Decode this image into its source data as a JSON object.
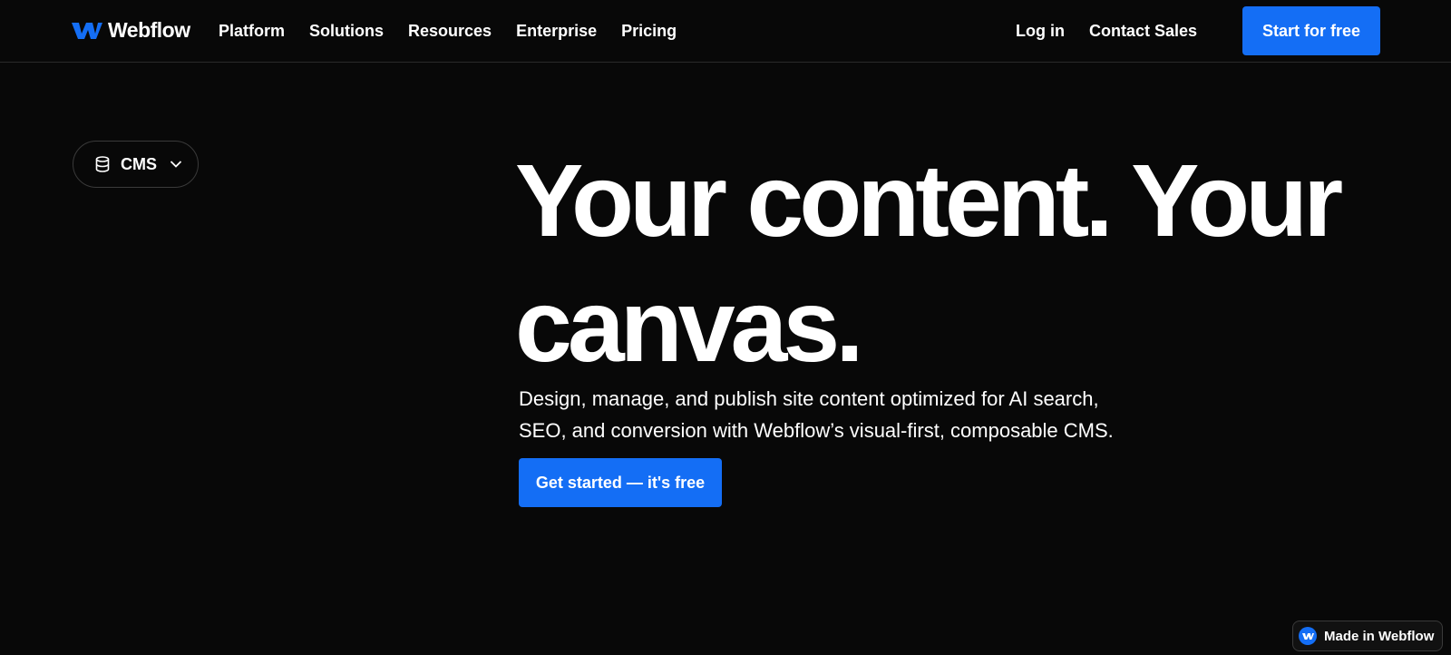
{
  "brand": {
    "name": "Webflow",
    "accent_color": "#146ef5",
    "logo_icon": "webflow-w-icon"
  },
  "nav": {
    "items": [
      {
        "label": "Platform"
      },
      {
        "label": "Solutions"
      },
      {
        "label": "Resources"
      },
      {
        "label": "Enterprise"
      },
      {
        "label": "Pricing"
      }
    ],
    "login_label": "Log in",
    "contact_label": "Contact Sales",
    "cta_label": "Start for free"
  },
  "product_selector": {
    "icon": "database-icon",
    "label": "CMS",
    "chevron_icon": "chevron-down-icon"
  },
  "hero": {
    "title_line1": "Your content. Your",
    "title_line2": "canvas.",
    "description": "Design, manage, and publish site content optimized for AI search, SEO, and conversion with Webflow’s visual-first, composable CMS.",
    "cta_label": "Get started — it's free"
  },
  "badge": {
    "label": "Made in Webflow"
  },
  "colors": {
    "background": "#080808",
    "text": "#ffffff",
    "divider": "#2a2a2a"
  }
}
